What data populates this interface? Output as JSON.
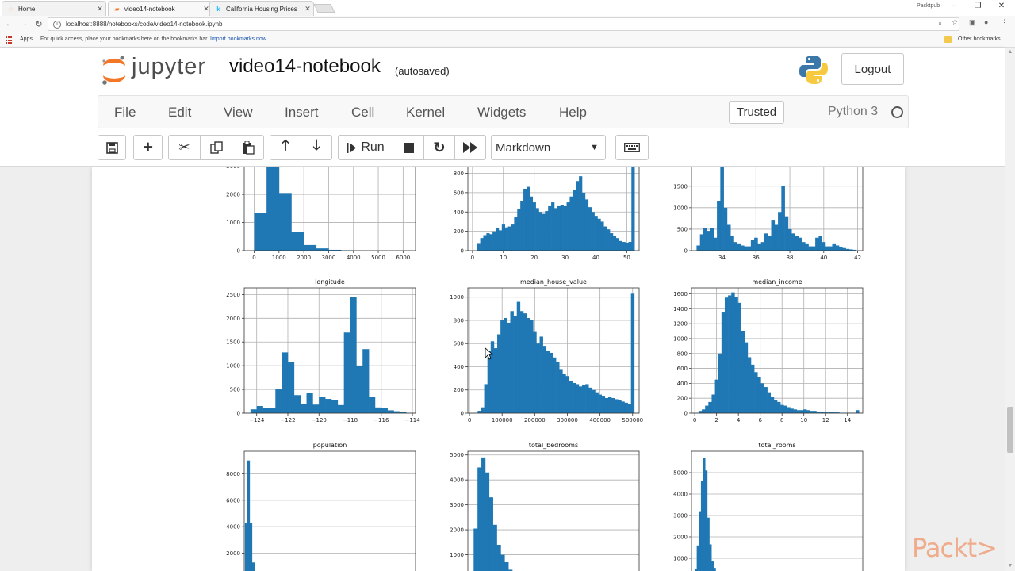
{
  "browser": {
    "tabs": [
      {
        "title": "Home",
        "icon": "jupyter-tab-icon"
      },
      {
        "title": "video14-notebook",
        "icon": "notebook-tab-icon"
      },
      {
        "title": "California Housing Prices",
        "icon": "kaggle-k-icon"
      }
    ],
    "profile": "Packtpub",
    "url": "localhost:8888/notebooks/code/video14-notebook.ipynb",
    "bookmarks": {
      "apps": "Apps",
      "hint": "For quick access, place your bookmarks here on the bookmarks bar.",
      "import": "Import bookmarks now...",
      "other": "Other bookmarks"
    }
  },
  "jupyter": {
    "logo_text": "jupyter",
    "notebook_name": "video14-notebook",
    "status": "(autosaved)",
    "logout": "Logout",
    "menu": [
      "File",
      "Edit",
      "View",
      "Insert",
      "Cell",
      "Kernel",
      "Widgets",
      "Help"
    ],
    "trusted": "Trusted",
    "kernel": "Python 3",
    "toolbar": {
      "run_label": "Run",
      "cell_type": "Markdown"
    }
  },
  "watermark": "Packt>",
  "chart_data": [
    {
      "type": "bar",
      "title": "",
      "truncated_top": true,
      "x": [
        250,
        750,
        1250,
        1750,
        2250,
        2750,
        3250,
        3750,
        4250,
        4750,
        5250,
        5750,
        6250
      ],
      "values": [
        1350,
        3600,
        2050,
        650,
        200,
        80,
        30,
        15,
        5,
        3,
        2,
        1,
        1
      ],
      "xticks": [
        0,
        1000,
        2000,
        3000,
        4000,
        5000,
        6000
      ],
      "yticks": [
        0,
        1000,
        2000,
        3000
      ],
      "xlim": [
        -400,
        6500
      ],
      "ylim": [
        0,
        3300
      ]
    },
    {
      "type": "bar",
      "title": "",
      "truncated_top": true,
      "x": [
        2,
        3,
        4,
        5,
        6,
        7,
        8,
        9,
        10,
        11,
        12,
        13,
        14,
        15,
        16,
        17,
        18,
        19,
        20,
        21,
        22,
        23,
        24,
        25,
        26,
        27,
        28,
        29,
        30,
        31,
        32,
        33,
        34,
        35,
        36,
        37,
        38,
        39,
        40,
        41,
        42,
        43,
        44,
        45,
        46,
        47,
        48,
        49,
        50,
        51,
        52
      ],
      "values": [
        70,
        130,
        160,
        180,
        170,
        200,
        230,
        210,
        270,
        240,
        250,
        270,
        350,
        430,
        510,
        640,
        660,
        560,
        500,
        440,
        400,
        380,
        410,
        460,
        500,
        440,
        460,
        470,
        460,
        500,
        560,
        630,
        720,
        770,
        600,
        530,
        450,
        400,
        360,
        330,
        300,
        250,
        220,
        180,
        150,
        130,
        100,
        90,
        80,
        90,
        1270
      ],
      "xticks": [
        0,
        10,
        20,
        30,
        40,
        50
      ],
      "yticks": [
        0,
        200,
        400,
        600,
        800
      ],
      "xlim": [
        -1.5,
        54
      ],
      "ylim": [
        0,
        960
      ]
    },
    {
      "type": "bar",
      "title": "",
      "truncated_top": true,
      "x": [
        32.6,
        32.8,
        33.0,
        33.2,
        33.4,
        33.6,
        33.8,
        34.0,
        34.2,
        34.4,
        34.6,
        34.8,
        35.0,
        35.2,
        35.4,
        35.6,
        35.8,
        36.0,
        36.2,
        36.4,
        36.6,
        36.8,
        37.0,
        37.2,
        37.4,
        37.6,
        37.8,
        38.0,
        38.2,
        38.4,
        38.6,
        38.8,
        39.0,
        39.2,
        39.4,
        39.6,
        39.8,
        40.0,
        40.2,
        40.4,
        40.6,
        40.8,
        41.0,
        41.2,
        41.4,
        41.6,
        41.8
      ],
      "values": [
        120,
        380,
        520,
        460,
        520,
        300,
        1150,
        3300,
        1000,
        600,
        350,
        200,
        150,
        120,
        100,
        100,
        250,
        300,
        150,
        200,
        400,
        350,
        700,
        600,
        900,
        1500,
        800,
        500,
        400,
        350,
        300,
        200,
        150,
        100,
        100,
        300,
        350,
        200,
        100,
        100,
        150,
        120,
        80,
        60,
        40,
        30,
        20
      ],
      "xticks": [
        34,
        36,
        38,
        40,
        42
      ],
      "yticks": [
        0,
        500,
        1000,
        1500,
        2000
      ],
      "xlim": [
        32.2,
        42.3
      ],
      "ylim": [
        0,
        2160
      ]
    },
    {
      "type": "bar",
      "title": "longitude",
      "x": [
        -124.2,
        -123.8,
        -123.4,
        -123.0,
        -122.6,
        -122.2,
        -121.8,
        -121.4,
        -121.0,
        -120.6,
        -120.2,
        -119.8,
        -119.4,
        -119.0,
        -118.6,
        -118.2,
        -117.8,
        -117.4,
        -117.0,
        -116.6,
        -116.2,
        -115.8,
        -115.4,
        -115.0,
        -114.6
      ],
      "values": [
        80,
        150,
        100,
        100,
        500,
        1280,
        1080,
        380,
        200,
        420,
        180,
        350,
        300,
        280,
        170,
        1700,
        2450,
        1000,
        1350,
        350,
        120,
        100,
        60,
        40,
        20
      ],
      "xticks": [
        -124,
        -122,
        -120,
        -118,
        -116,
        -114
      ],
      "yticks": [
        0,
        500,
        1000,
        1500,
        2000,
        2500
      ],
      "xlim": [
        -124.8,
        -113.8
      ],
      "ylim": [
        0,
        2640
      ]
    },
    {
      "type": "bar",
      "title": "median_house_value",
      "x": [
        30000,
        40000,
        50000,
        60000,
        70000,
        80000,
        90000,
        100000,
        110000,
        120000,
        130000,
        140000,
        150000,
        160000,
        170000,
        180000,
        190000,
        200000,
        210000,
        220000,
        230000,
        240000,
        250000,
        260000,
        270000,
        280000,
        290000,
        300000,
        310000,
        320000,
        330000,
        340000,
        350000,
        360000,
        370000,
        380000,
        390000,
        400000,
        410000,
        420000,
        430000,
        440000,
        450000,
        460000,
        470000,
        480000,
        490000,
        500000
      ],
      "values": [
        20,
        50,
        250,
        540,
        620,
        560,
        680,
        800,
        820,
        780,
        880,
        840,
        960,
        880,
        860,
        820,
        800,
        700,
        600,
        660,
        580,
        540,
        520,
        480,
        440,
        380,
        340,
        320,
        280,
        260,
        250,
        230,
        240,
        250,
        220,
        200,
        180,
        160,
        150,
        130,
        140,
        130,
        120,
        110,
        100,
        90,
        80,
        1030
      ],
      "xticks": [
        0,
        100000,
        200000,
        300000,
        400000,
        500000
      ],
      "yticks": [
        0,
        200,
        400,
        600,
        800,
        1000
      ],
      "xlim": [
        -5000,
        520000
      ],
      "ylim": [
        0,
        1080
      ]
    },
    {
      "type": "bar",
      "title": "median_income",
      "x": [
        0.5,
        0.8,
        1.1,
        1.4,
        1.7,
        2.0,
        2.3,
        2.6,
        2.9,
        3.2,
        3.5,
        3.8,
        4.1,
        4.4,
        4.7,
        5.0,
        5.3,
        5.6,
        5.9,
        6.2,
        6.5,
        6.8,
        7.1,
        7.4,
        7.7,
        8.0,
        8.3,
        8.6,
        8.9,
        9.2,
        9.5,
        9.8,
        10.1,
        10.4,
        10.7,
        11.0,
        11.3,
        11.6,
        11.9,
        12.2,
        12.5,
        12.8,
        13.1,
        13.4,
        13.7,
        14.0,
        14.3,
        14.6,
        14.9
      ],
      "values": [
        30,
        50,
        100,
        150,
        250,
        450,
        800,
        1350,
        1550,
        1580,
        1620,
        1560,
        1480,
        1100,
        950,
        750,
        650,
        550,
        480,
        400,
        350,
        280,
        220,
        180,
        150,
        110,
        100,
        80,
        60,
        50,
        40,
        40,
        50,
        40,
        30,
        30,
        20,
        20,
        10,
        10,
        20,
        10,
        10,
        5,
        5,
        5,
        5,
        5,
        40
      ],
      "xticks": [
        0,
        2,
        4,
        6,
        8,
        10,
        12,
        14
      ],
      "yticks": [
        0,
        200,
        400,
        600,
        800,
        1000,
        1200,
        1400,
        1600
      ],
      "xlim": [
        -0.3,
        15.4
      ],
      "ylim": [
        0,
        1680
      ]
    },
    {
      "type": "bar",
      "title": "population",
      "truncated_bottom": true,
      "x": [
        100,
        600,
        1100,
        1600,
        2100,
        2600
      ],
      "values": [
        4300,
        9000,
        4300,
        1300,
        500,
        200
      ],
      "yticks": [
        2000,
        4000,
        6000,
        8000
      ],
      "xlim": [
        -300,
        36000
      ],
      "ylim": [
        0,
        9700
      ]
    },
    {
      "type": "bar",
      "title": "total_bedrooms",
      "truncated_bottom": true,
      "x": [
        150,
        300,
        450,
        600,
        750,
        900,
        1050,
        1200,
        1350,
        1500,
        1650
      ],
      "values": [
        2050,
        4500,
        4900,
        4300,
        3300,
        2200,
        1400,
        1000,
        700,
        400,
        250
      ],
      "yticks": [
        1000,
        2000,
        3000,
        4000,
        5000
      ],
      "xlim": [
        -150,
        6500
      ],
      "ylim": [
        0,
        5150
      ]
    },
    {
      "type": "bar",
      "title": "total_rooms",
      "truncated_bottom": true,
      "x": [
        250,
        750,
        1250,
        1750,
        2250,
        2750,
        3250,
        3750,
        4250,
        4750,
        5250,
        5750
      ],
      "values": [
        500,
        1600,
        3200,
        4600,
        5700,
        5100,
        2900,
        1650,
        850,
        550,
        350,
        200
      ],
      "yticks": [
        1000,
        2000,
        3000,
        4000,
        5000
      ],
      "xlim": [
        -750,
        40000
      ],
      "ylim": [
        0,
        6000
      ]
    }
  ]
}
